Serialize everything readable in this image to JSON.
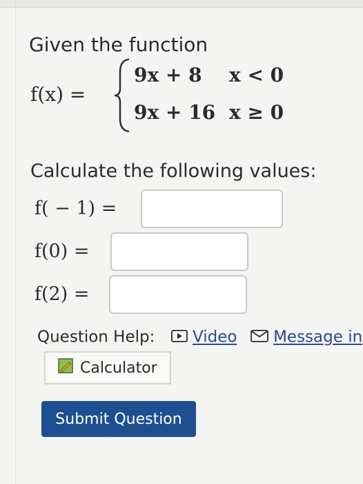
{
  "problem": {
    "intro": "Given the function",
    "function_name": "f(x) =",
    "pieces": [
      {
        "expr": "9x + 8",
        "condition": "x < 0"
      },
      {
        "expr": "9x + 16",
        "condition": "x ≥ 0"
      }
    ],
    "calc_prompt": "Calculate the following values:"
  },
  "questions": [
    {
      "label": "f( − 1) =",
      "value": ""
    },
    {
      "label": "f(0) =",
      "value": ""
    },
    {
      "label": "f(2) =",
      "value": ""
    }
  ],
  "help": {
    "label": "Question Help:",
    "video_label": "Video",
    "message_label": "Message in",
    "video_icon": "video-icon",
    "message_icon": "mail-icon"
  },
  "calculator": {
    "label": "Calculator",
    "icon": "calculator-icon"
  },
  "submit": {
    "label": "Submit Question"
  },
  "colors": {
    "accent": "#1d4f91",
    "link": "#2a4a8a",
    "background": "#f4f4f2"
  }
}
